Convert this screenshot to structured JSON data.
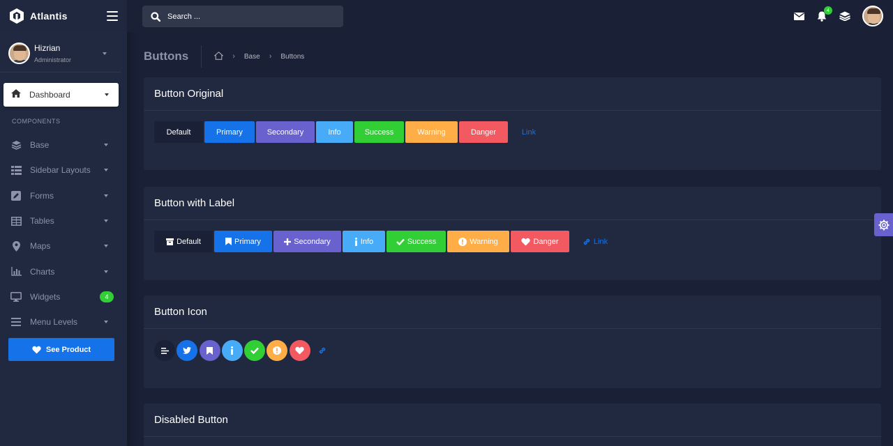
{
  "app": {
    "name": "Atlantis"
  },
  "user": {
    "name": "Hizrian",
    "role": "Administrator"
  },
  "sidebar": {
    "active": {
      "label": "Dashboard",
      "icon": "home-icon"
    },
    "section": "COMPONENTS",
    "items": [
      {
        "label": "Base",
        "icon": "layers-icon"
      },
      {
        "label": "Sidebar Layouts",
        "icon": "list-icon"
      },
      {
        "label": "Forms",
        "icon": "pen-square-icon"
      },
      {
        "label": "Tables",
        "icon": "table-icon"
      },
      {
        "label": "Maps",
        "icon": "map-marker-icon"
      },
      {
        "label": "Charts",
        "icon": "bar-chart-icon"
      },
      {
        "label": "Widgets",
        "icon": "desktop-icon",
        "badge": "4"
      },
      {
        "label": "Menu Levels",
        "icon": "menu-icon"
      }
    ],
    "see_product": "See Product"
  },
  "header": {
    "search_placeholder": "Search ...",
    "notification_count": "4"
  },
  "page": {
    "title": "Buttons",
    "breadcrumb": [
      "Base",
      "Buttons"
    ]
  },
  "cards": {
    "original": {
      "title": "Button Original",
      "buttons": [
        "Default",
        "Primary",
        "Secondary",
        "Info",
        "Success",
        "Warning",
        "Danger",
        "Link"
      ]
    },
    "label": {
      "title": "Button with Label",
      "buttons": [
        "Default",
        "Primary",
        "Secondary",
        "Info",
        "Success",
        "Warning",
        "Danger",
        "Link"
      ]
    },
    "icon": {
      "title": "Button Icon",
      "icons": [
        "align-left-icon",
        "twitter-icon",
        "bookmark-icon",
        "info-icon",
        "check-icon",
        "exclamation-circle-icon",
        "heart-icon",
        "link-icon"
      ]
    },
    "disabled": {
      "title": "Disabled Button"
    }
  },
  "colors": {
    "default": "#1a2035",
    "primary": "#1572e8",
    "secondary": "#6861ce",
    "info": "#48abf7",
    "success": "#31ce36",
    "warning": "#ffad46",
    "danger": "#f25961",
    "link": "#1572e8"
  }
}
